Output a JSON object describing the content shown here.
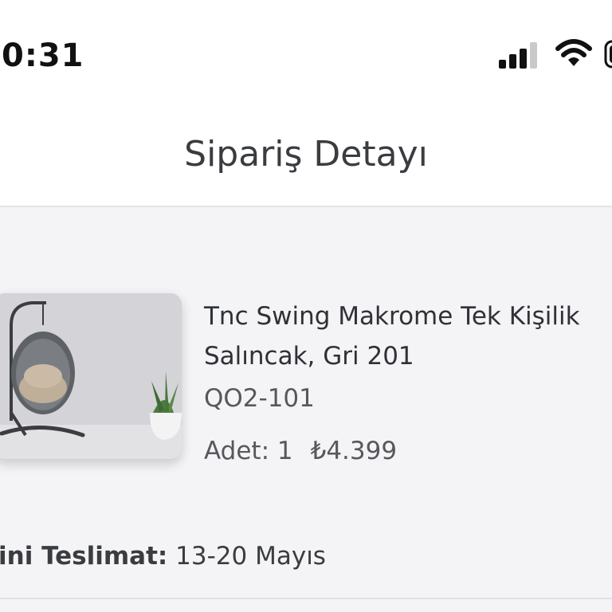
{
  "status_bar": {
    "time": "0:31",
    "icons": [
      "signal-icon",
      "wifi-icon",
      "battery-icon"
    ]
  },
  "header": {
    "title": "Sipariş Detayı"
  },
  "order_item": {
    "image_icon": "hanging-egg-chair-photo",
    "name": "Tnc Swing Makrome Tek Kişilik Salıncak, Gri 201",
    "sku": "QO2-101",
    "quantity_text": "Adet: 1",
    "price": "₺4.399"
  },
  "delivery": {
    "label": "ini Teslimat:",
    "value": "13-20 Mayıs"
  }
}
